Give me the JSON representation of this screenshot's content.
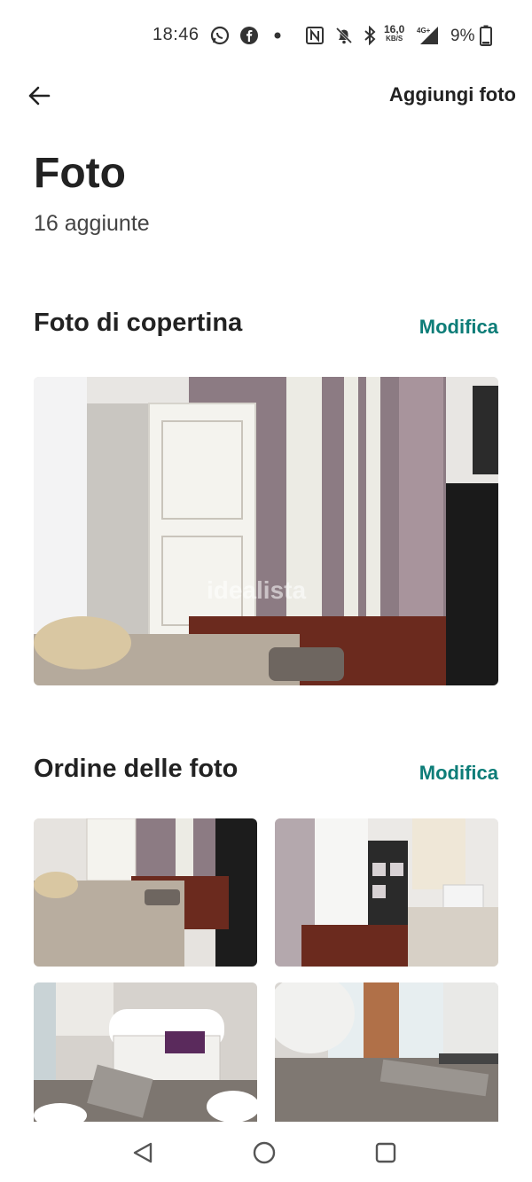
{
  "status_bar": {
    "time": "18:46",
    "speed_value": "16,0",
    "speed_unit": "KB/S",
    "network": "4G+",
    "battery": "9%",
    "icons": [
      "whatsapp-icon",
      "facebook-icon",
      "dot-icon",
      "nfc-icon",
      "mute-icon",
      "bluetooth-icon",
      "signal-icon",
      "battery-icon"
    ]
  },
  "header": {
    "back_icon": "arrow-left-icon",
    "add_photo_label": "Aggiungi foto"
  },
  "page": {
    "title": "Foto",
    "subtitle": "16 aggiunte"
  },
  "cover_section": {
    "title": "Foto di copertina",
    "action_label": "Modifica",
    "watermark": "idealista"
  },
  "order_section": {
    "title": "Ordine delle foto",
    "action_label": "Modifica",
    "thumbnails": [
      "bedroom-wardrobe-photo",
      "bedroom-window-photo",
      "bathroom-sink-photo",
      "bathroom-shower-photo"
    ]
  },
  "nav_bar": {
    "icons": [
      "nav-back-icon",
      "nav-home-icon",
      "nav-recent-icon"
    ]
  },
  "colors": {
    "accent": "#0d7d78",
    "text": "#222222"
  }
}
